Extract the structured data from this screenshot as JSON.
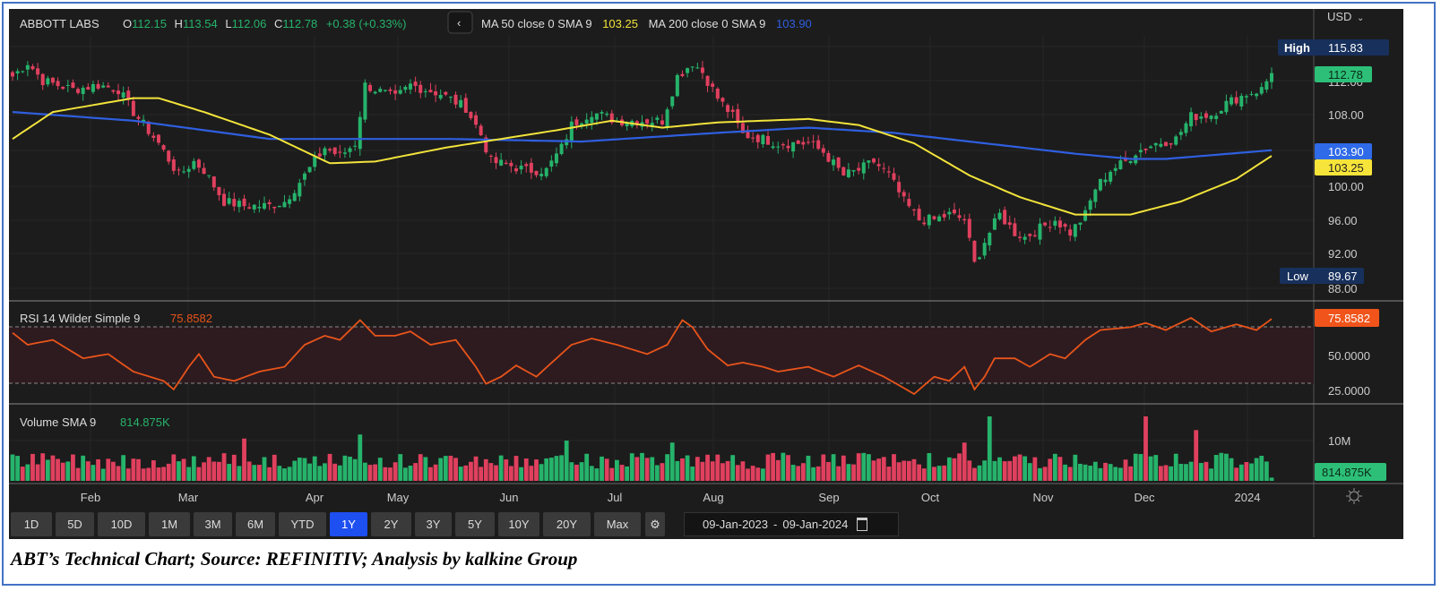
{
  "header": {
    "name": "ABBOTT LABS",
    "o_label": "O",
    "o": "112.15",
    "h_label": "H",
    "h": "113.54",
    "l_label": "L",
    "l": "112.06",
    "c_label": "C",
    "c": "112.78",
    "change": "+0.38 (+0.33%)",
    "collapse_icon": "chevron-left-icon",
    "ma50_label": "MA 50 close 0 SMA 9",
    "ma50_value": "103.25",
    "ma200_label": "MA 200 close 0 SMA 9",
    "ma200_value": "103.90"
  },
  "currency": "USD",
  "price_axis": {
    "ticks": [
      "108.00",
      "100.00",
      "96.00",
      "92.00",
      "88.00"
    ],
    "high_label": "High",
    "high_value": "115.83",
    "low_label": "Low",
    "low_value": "89.67",
    "last_price": "112.78",
    "ma200_tag": "103.90",
    "ma50_tag": "103.25",
    "partial_tick": "112.00"
  },
  "rsi": {
    "label": "RSI 14 Wilder Simple 9",
    "value": "75.8582",
    "ticks": [
      "50.0000",
      "25.0000"
    ]
  },
  "volume": {
    "label": "Volume SMA 9",
    "value": "814.875K",
    "ticks": [
      "10M"
    ]
  },
  "x_axis": {
    "labels": [
      "Feb",
      "Mar",
      "Apr",
      "May",
      "Jun",
      "Jul",
      "Aug",
      "Sep",
      "Oct",
      "Nov",
      "Dec",
      "2024"
    ]
  },
  "periods": {
    "items": [
      "1D",
      "5D",
      "10D",
      "1M",
      "3M",
      "6M",
      "YTD",
      "1Y",
      "2Y",
      "3Y",
      "5Y",
      "10Y",
      "20Y",
      "Max"
    ],
    "active": "1Y"
  },
  "date_range": {
    "from": "09-Jan-2023",
    "sep": "-",
    "to": "09-Jan-2024"
  },
  "caption": "ABT’s Technical Chart; Source: REFINITIV; Analysis by kalkine Group",
  "colors": {
    "up": "#26b36b",
    "down": "#e0405e",
    "ma50": "#f2e33b",
    "ma200": "#2f5fe0",
    "rsi": "#e8541a",
    "accent": "#1e4ff0"
  },
  "chart_data": {
    "type": "candlestick",
    "title": "ABBOTT LABS",
    "x_range": [
      "09-Jan-2023",
      "09-Jan-2024"
    ],
    "trading_days": 250,
    "ylim": [
      87,
      117
    ],
    "close_keypoints": [
      [
        0,
        112.4
      ],
      [
        3,
        114
      ],
      [
        6,
        111.9
      ],
      [
        12,
        110.9
      ],
      [
        17,
        111.4
      ],
      [
        21,
        110.9
      ],
      [
        24,
        108.3
      ],
      [
        29,
        104.7
      ],
      [
        33,
        101
      ],
      [
        36,
        102.6
      ],
      [
        38,
        101.6
      ],
      [
        42,
        98
      ],
      [
        46,
        97.5
      ],
      [
        51,
        97.5
      ],
      [
        54,
        98
      ],
      [
        58,
        101
      ],
      [
        62,
        104.2
      ],
      [
        65,
        103.2
      ],
      [
        68,
        104.7
      ],
      [
        70,
        111.4
      ],
      [
        72,
        110.9
      ],
      [
        76,
        109.9
      ],
      [
        79,
        111.4
      ],
      [
        85,
        110.4
      ],
      [
        90,
        108.8
      ],
      [
        93,
        105.7
      ],
      [
        95,
        102.6
      ],
      [
        99,
        102.1
      ],
      [
        102,
        101.6
      ],
      [
        106,
        101.6
      ],
      [
        109,
        104.2
      ],
      [
        111,
        106.8
      ],
      [
        115,
        108.3
      ],
      [
        120,
        107.3
      ],
      [
        126,
        107.3
      ],
      [
        129,
        107.3
      ],
      [
        132,
        112.4
      ],
      [
        135,
        114
      ],
      [
        137,
        112.9
      ],
      [
        140,
        109.9
      ],
      [
        143,
        107.8
      ],
      [
        145,
        105.7
      ],
      [
        149,
        105.2
      ],
      [
        152,
        104.7
      ],
      [
        158,
        104.7
      ],
      [
        161,
        103.7
      ],
      [
        165,
        101
      ],
      [
        168,
        101.6
      ],
      [
        171,
        102.6
      ],
      [
        174,
        101
      ],
      [
        177,
        98
      ],
      [
        180,
        95.9
      ],
      [
        183,
        95.9
      ],
      [
        186,
        96.5
      ],
      [
        189,
        95.9
      ],
      [
        191,
        90.8
      ],
      [
        193,
        93.4
      ],
      [
        196,
        96.5
      ],
      [
        199,
        94.4
      ],
      [
        201,
        93.9
      ],
      [
        204,
        94.9
      ],
      [
        207,
        95.9
      ],
      [
        210,
        94.4
      ],
      [
        213,
        96.5
      ],
      [
        215,
        99.5
      ],
      [
        218,
        101.6
      ],
      [
        221,
        102.6
      ],
      [
        223,
        103.7
      ],
      [
        227,
        104.7
      ],
      [
        231,
        105.2
      ],
      [
        234,
        107.8
      ],
      [
        238,
        108
      ],
      [
        241,
        109.3
      ],
      [
        245,
        110.4
      ],
      [
        248,
        110.9
      ],
      [
        250,
        112.78
      ]
    ],
    "ma50_keypoints": [
      [
        0,
        105.2
      ],
      [
        8,
        108.3
      ],
      [
        24,
        109.9
      ],
      [
        29,
        109.9
      ],
      [
        38,
        108.3
      ],
      [
        51,
        105.7
      ],
      [
        63,
        102.4
      ],
      [
        72,
        102.6
      ],
      [
        86,
        104.2
      ],
      [
        97,
        105.2
      ],
      [
        108,
        106.2
      ],
      [
        119,
        107.3
      ],
      [
        129,
        106.5
      ],
      [
        140,
        107.1
      ],
      [
        158,
        107.5
      ],
      [
        168,
        106.8
      ],
      [
        179,
        104.7
      ],
      [
        190,
        101
      ],
      [
        200,
        98.5
      ],
      [
        211,
        96.5
      ],
      [
        222,
        96.5
      ],
      [
        232,
        98
      ],
      [
        243,
        100.6
      ],
      [
        250,
        103.25
      ]
    ],
    "ma200_keypoints": [
      [
        0,
        108.3
      ],
      [
        24,
        107.3
      ],
      [
        51,
        105.2
      ],
      [
        87,
        105.2
      ],
      [
        113,
        104.9
      ],
      [
        140,
        105.9
      ],
      [
        158,
        106.5
      ],
      [
        175,
        105.9
      ],
      [
        193,
        104.7
      ],
      [
        211,
        103.5
      ],
      [
        222,
        102.9
      ],
      [
        229,
        102.9
      ],
      [
        250,
        103.9
      ]
    ],
    "rsi_keypoints": [
      [
        0,
        66
      ],
      [
        3,
        57.6
      ],
      [
        8,
        61
      ],
      [
        14,
        48
      ],
      [
        19,
        51
      ],
      [
        24,
        38.6
      ],
      [
        30,
        32
      ],
      [
        32,
        26
      ],
      [
        35,
        42
      ],
      [
        37,
        51
      ],
      [
        40,
        35
      ],
      [
        44,
        32
      ],
      [
        49,
        38.6
      ],
      [
        54,
        42
      ],
      [
        58,
        57.6
      ],
      [
        62,
        64
      ],
      [
        65,
        61
      ],
      [
        69,
        75
      ],
      [
        72,
        64
      ],
      [
        76,
        64
      ],
      [
        79,
        67
      ],
      [
        83,
        57.6
      ],
      [
        88,
        61
      ],
      [
        92,
        42
      ],
      [
        94,
        30
      ],
      [
        97,
        35
      ],
      [
        100,
        43
      ],
      [
        104,
        35
      ],
      [
        108,
        48
      ],
      [
        111,
        57.6
      ],
      [
        115,
        62
      ],
      [
        120,
        57.6
      ],
      [
        126,
        51
      ],
      [
        130,
        57.6
      ],
      [
        133,
        75
      ],
      [
        135,
        70
      ],
      [
        138,
        54.4
      ],
      [
        142,
        43
      ],
      [
        145,
        45
      ],
      [
        149,
        42
      ],
      [
        152,
        38.6
      ],
      [
        158,
        42
      ],
      [
        163,
        35
      ],
      [
        168,
        43
      ],
      [
        173,
        35
      ],
      [
        176,
        29
      ],
      [
        179,
        22.8
      ],
      [
        183,
        35
      ],
      [
        186,
        32
      ],
      [
        189,
        42
      ],
      [
        191,
        26
      ],
      [
        193,
        35
      ],
      [
        195,
        48
      ],
      [
        199,
        48
      ],
      [
        202,
        42
      ],
      [
        206,
        51
      ],
      [
        209,
        48
      ],
      [
        213,
        61
      ],
      [
        216,
        68
      ],
      [
        222,
        70
      ],
      [
        225,
        73
      ],
      [
        229,
        68
      ],
      [
        234,
        76.6
      ],
      [
        238,
        67
      ],
      [
        243,
        72
      ],
      [
        247,
        68
      ],
      [
        250,
        75.86
      ]
    ],
    "rsi_ylim": [
      15,
      90
    ],
    "rsi_bands": [
      30,
      70
    ],
    "volume_base_millions": 5,
    "volume_spikes_millions": [
      [
        46,
        10.5
      ],
      [
        69,
        11.5
      ],
      [
        110,
        10
      ],
      [
        131,
        9.5
      ],
      [
        189,
        9.5
      ],
      [
        194,
        16
      ],
      [
        225,
        16
      ],
      [
        235,
        12.6
      ]
    ],
    "volume_last_millions": 0.81
  }
}
